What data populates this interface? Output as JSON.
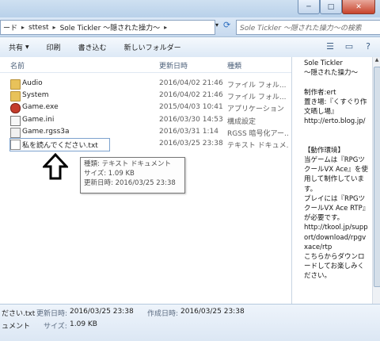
{
  "window": {
    "minimize_label": "─",
    "maximize_label": "□",
    "close_label": "✕"
  },
  "address": {
    "crumbs": [
      "ード",
      "sttest",
      "Sole Tickler ～隠された操力～"
    ],
    "search_placeholder": "Sole Tickler ～隠された操力～の検索"
  },
  "toolbar": {
    "share_label": "共有",
    "print_label": "印刷",
    "burn_label": "書き込む",
    "new_folder_label": "新しいフォルダー"
  },
  "columns": {
    "name": "名前",
    "modified": "更新日時",
    "type": "種類"
  },
  "files": [
    {
      "name": "Audio",
      "modified": "2016/04/02 21:46",
      "type": "ファイル フォル...",
      "icon": "folder-icon"
    },
    {
      "name": "System",
      "modified": "2016/04/02 21:46",
      "type": "ファイル フォル...",
      "icon": "folder-icon"
    },
    {
      "name": "Game.exe",
      "modified": "2015/04/03 10:41",
      "type": "アプリケーション",
      "icon": "exe-icon"
    },
    {
      "name": "Game.ini",
      "modified": "2016/03/30 14:53",
      "type": "構成設定",
      "icon": "ini-icon"
    },
    {
      "name": "Game.rgss3a",
      "modified": "2016/03/31 1:14",
      "type": "RGSS 暗号化アー...",
      "icon": "rgss-icon"
    },
    {
      "name": "私を読んでください.txt",
      "modified": "2016/03/25 23:38",
      "type": "テキスト ドキュメ...",
      "icon": "text-document-icon"
    }
  ],
  "tooltip": {
    "type_line": "種類: テキスト ドキュメント",
    "size_line": "サイズ: 1.09 KB",
    "modified_line": "更新日時: 2016/03/25 23:38"
  },
  "preview": {
    "text": "Sole Tickler\n～隠された操力～\n\n制作者:ert\n置き場:『くすぐり作文晒し場』\nhttp://erto.blog.jp/\n\n\n【動作環境】\n当ゲームは『RPGツクールVX Ace』を使用して制作しています。\nプレイには『RPGツクールVX Ace RTP』が必要です。\nhttp://tkool.jp/support/download/rpgvxace/rtp\nこちらからダウンロードしてお楽しみください。"
  },
  "details": {
    "filename": "ださい.txt",
    "modified_label": "更新日時:",
    "modified_value": "2016/03/25 23:38",
    "created_label": "作成日時:",
    "created_value": "2016/03/25 23:38",
    "type_value": "ュメント",
    "size_label": "サイズ:",
    "size_value": "1.09 KB"
  }
}
